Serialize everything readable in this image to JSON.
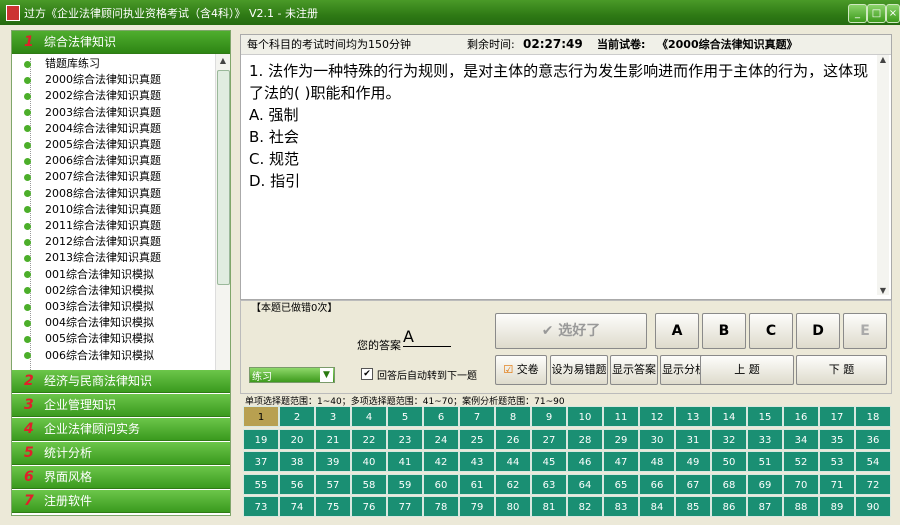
{
  "window": {
    "title": "过方《企业法律顾问执业资格考试（含4科）》  V2.1 - 未注册"
  },
  "sidebar": {
    "sections": [
      {
        "num": "1",
        "label": "综合法律知识"
      },
      {
        "num": "2",
        "label": "经济与民商法律知识"
      },
      {
        "num": "3",
        "label": "企业管理知识"
      },
      {
        "num": "4",
        "label": "企业法律顾问实务"
      },
      {
        "num": "5",
        "label": "统计分析"
      },
      {
        "num": "6",
        "label": "界面风格"
      },
      {
        "num": "7",
        "label": "注册软件"
      }
    ],
    "tree": [
      "错题库练习",
      "2000综合法律知识真题",
      "2002综合法律知识真题",
      "2003综合法律知识真题",
      "2004综合法律知识真题",
      "2005综合法律知识真题",
      "2006综合法律知识真题",
      "2007综合法律知识真题",
      "2008综合法律知识真题",
      "2010综合法律知识真题",
      "2011综合法律知识真题",
      "2012综合法律知识真题",
      "2013综合法律知识真题",
      "001综合法律知识模拟",
      "002综合法律知识模拟",
      "003综合法律知识模拟",
      "004综合法律知识模拟",
      "005综合法律知识模拟",
      "006综合法律知识模拟"
    ]
  },
  "header": {
    "time_note": "每个科目的考试时间均为150分钟",
    "remaining_label": "剩余时间:",
    "remaining_time": "02:27:49",
    "paper_label": "当前试卷:",
    "paper_name": "《2000综合法律知识真题》"
  },
  "question": {
    "text": "1. 法作为一种特殊的行为规则，是对主体的意志行为发生影响进而作用于主体的行为，这体现了法的(      )职能和作用。",
    "options": [
      "A. 强制",
      "B. 社会",
      "C. 规范",
      "D. 指引"
    ]
  },
  "panel": {
    "done_count": "【本题已做错0次】",
    "your_answer_label": "您的答案",
    "your_answer": "A",
    "selected_label": "选好了",
    "choice_buttons": [
      "A",
      "B",
      "C",
      "D",
      "E"
    ],
    "mode_select": "练习",
    "auto_next_label": "回答后自动转到下一题",
    "exchange_label": "交卷",
    "mark_label": "设为易错题",
    "show_answer": "显示答案",
    "show_analysis": "显示分析",
    "prev_label": "上  题",
    "next_label": "下  题"
  },
  "grid_header": "单项选择题范围：1~40；多项选择题范围：41~70；案例分析题范围：71~90",
  "grid_numbers": [
    1,
    2,
    3,
    4,
    5,
    6,
    7,
    8,
    9,
    10,
    11,
    12,
    13,
    14,
    15,
    16,
    17,
    18,
    19,
    20,
    21,
    22,
    23,
    24,
    25,
    26,
    27,
    28,
    29,
    30,
    31,
    32,
    33,
    34,
    35,
    36,
    37,
    38,
    39,
    40,
    41,
    42,
    43,
    44,
    45,
    46,
    47,
    48,
    49,
    50,
    51,
    52,
    53,
    54,
    55,
    56,
    57,
    58,
    59,
    60,
    61,
    62,
    63,
    64,
    65,
    66,
    67,
    68,
    69,
    70,
    71,
    72,
    73,
    74,
    75,
    76,
    77,
    78,
    79,
    80,
    81,
    82,
    83,
    84,
    85,
    86,
    87,
    88,
    89,
    90
  ],
  "current_question": 1,
  "colors": {
    "title_green": "#2f7a15",
    "grid_cell": "#1a8f73",
    "current_cell": "#b8a050",
    "section_num": "#e0202a"
  }
}
